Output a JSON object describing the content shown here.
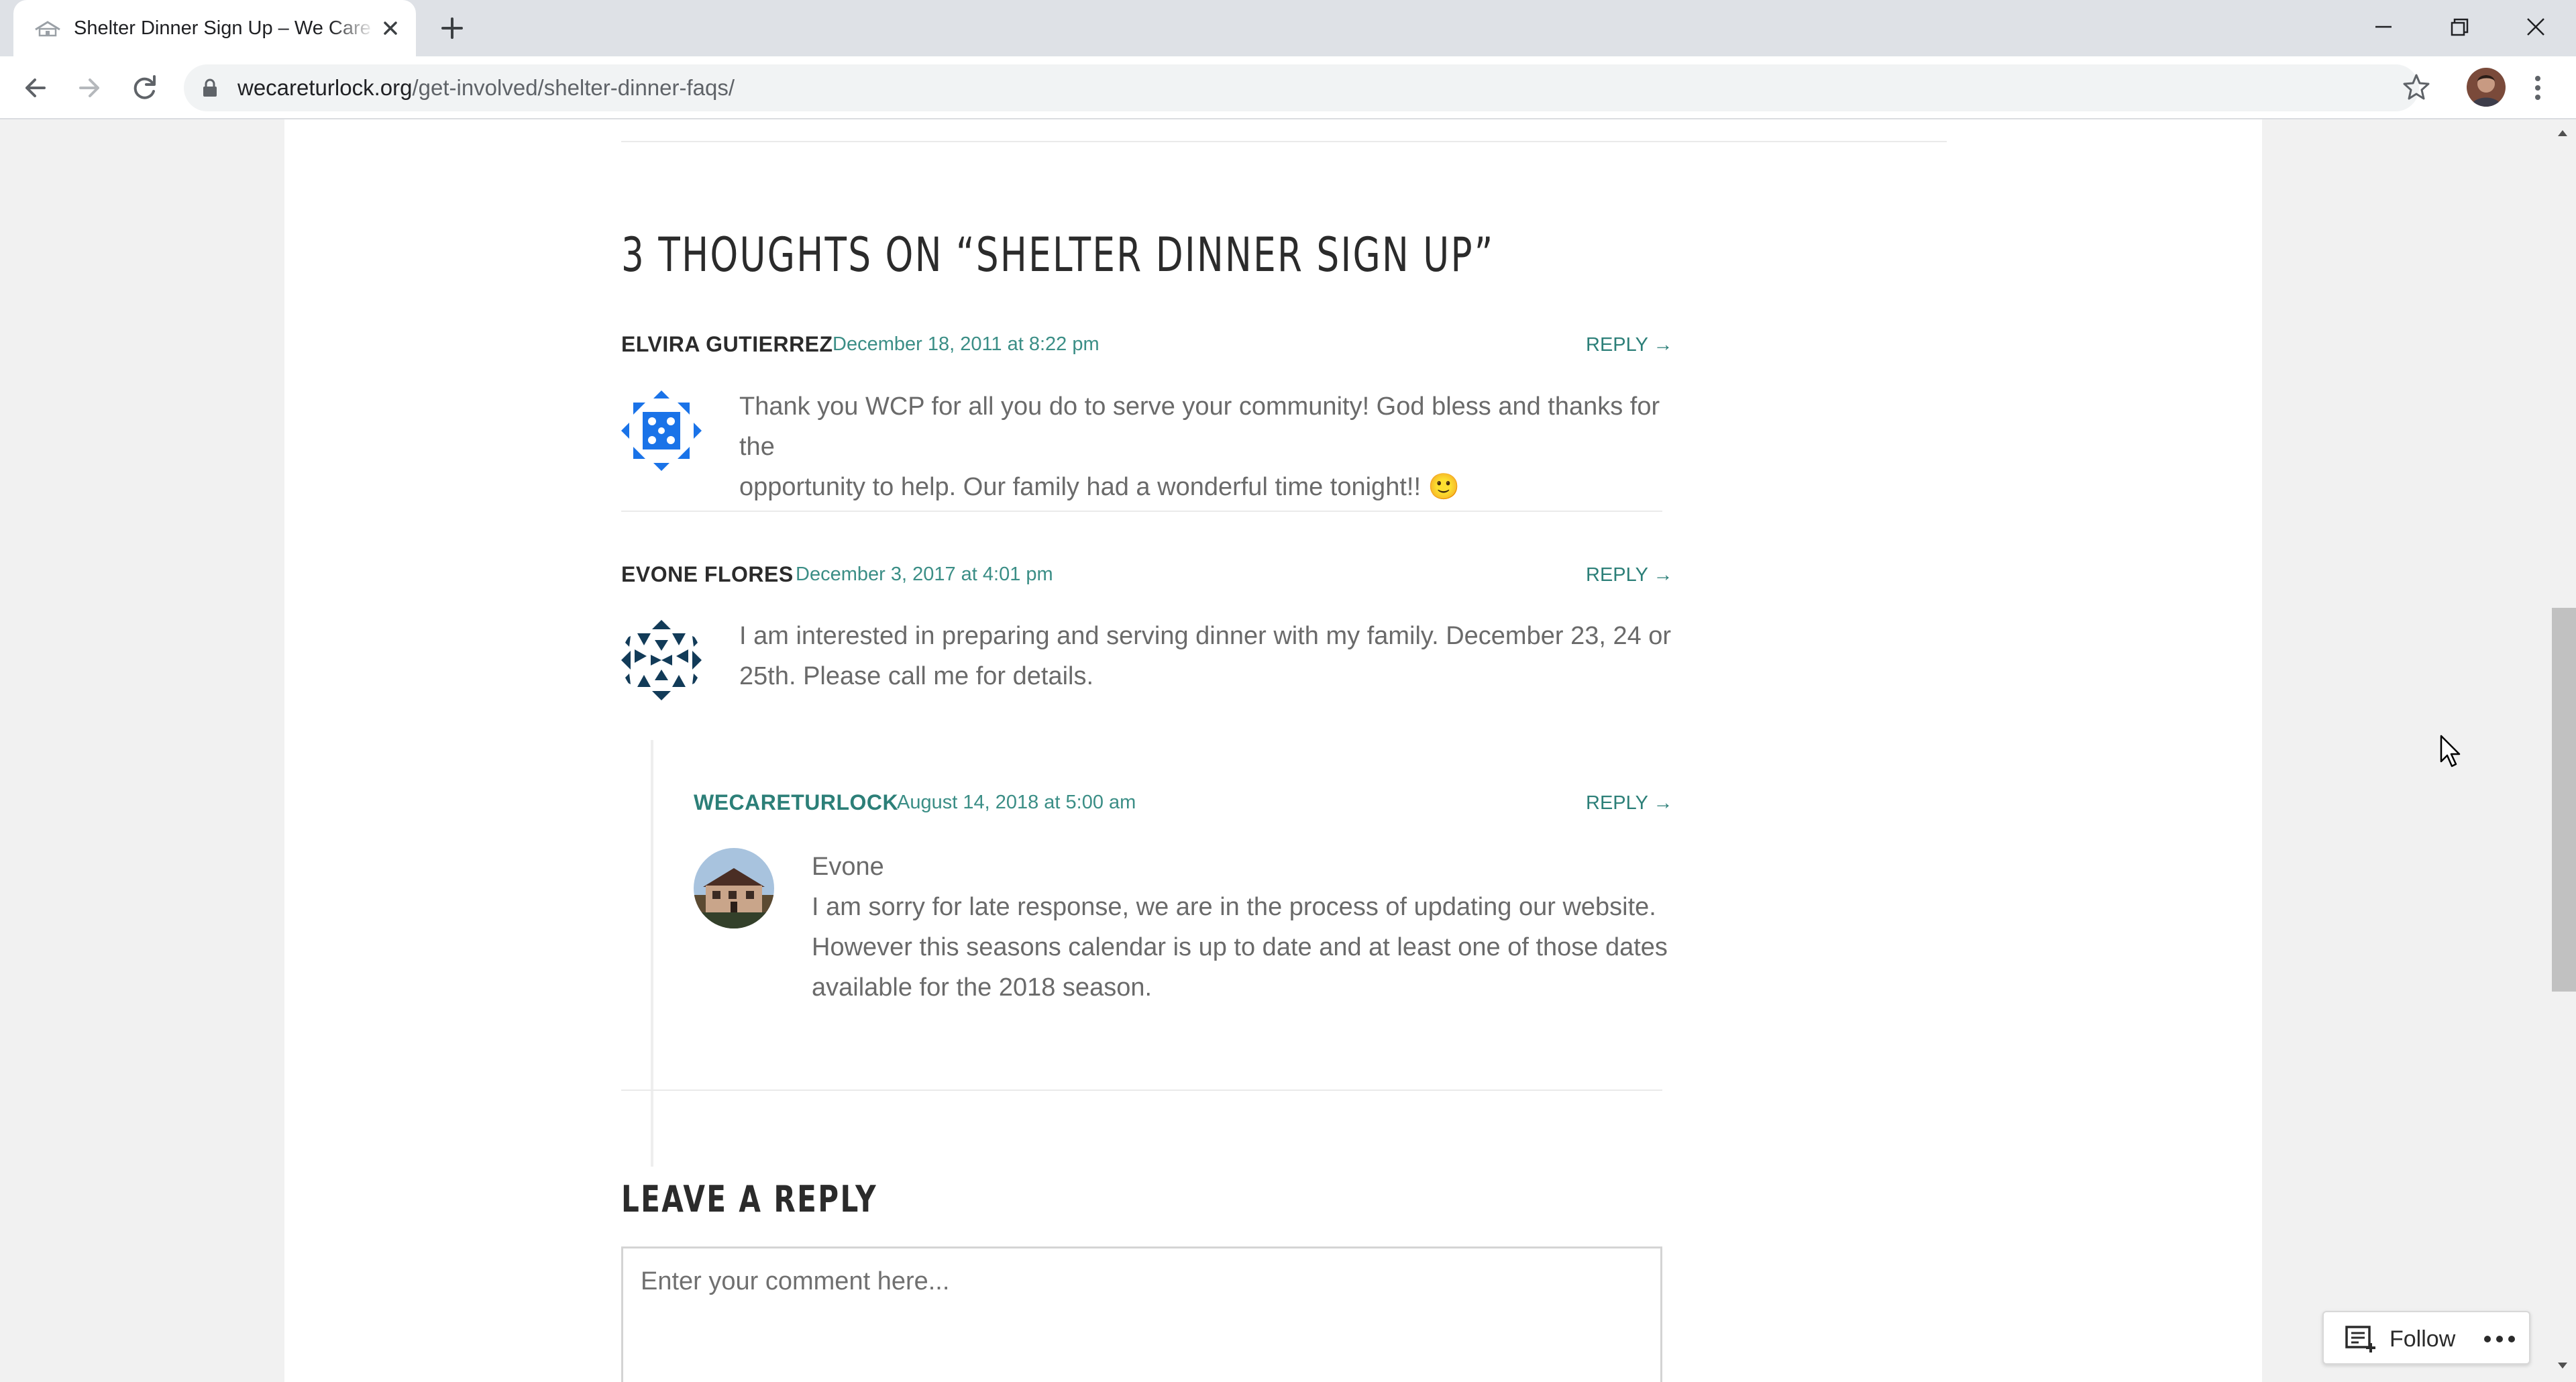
{
  "browser": {
    "tab_title": "Shelter Dinner Sign Up – We Care Turlock",
    "url_host": "wecareturlock.org",
    "url_path": "/get-involved/shelter-dinner-faqs/"
  },
  "comments": {
    "heading": "3 THOUGHTS ON “SHELTER DINNER SIGN UP”",
    "items": [
      {
        "author": "ELVIRA GUTIERREZ",
        "date": "December 18, 2011 at 8:22 pm",
        "reply_label": "REPLY →",
        "lines": [
          "Thank you WCP for all you do to serve your community! God bless and thanks for the",
          "opportunity to help. Our family had a wonderful time tonight!! 🙂"
        ]
      },
      {
        "author": "EVONE FLORES",
        "date": "December 3, 2017 at 4:01 pm",
        "reply_label": "REPLY →",
        "lines": [
          "I am interested in preparing and serving dinner with my family. December 23, 24 or",
          "25th. Please call me for details."
        ]
      },
      {
        "author": "WECARETURLOCK",
        "date": "August 14, 2018 at 5:00 am",
        "reply_label": "REPLY →",
        "lines": [
          "Evone",
          "I am sorry for late response, we are in the process of updating our website.",
          "However this seasons calendar is up to date and at least one of those dates",
          "available for the 2018 season."
        ]
      }
    ]
  },
  "reply_form": {
    "heading": "LEAVE A REPLY",
    "placeholder": "Enter your comment here..."
  },
  "follow_widget": {
    "label": "Follow"
  },
  "colors": {
    "accent_teal": "#2c7f78",
    "avatar_blue": "#1a73e8",
    "avatar_navy": "#123b58"
  }
}
